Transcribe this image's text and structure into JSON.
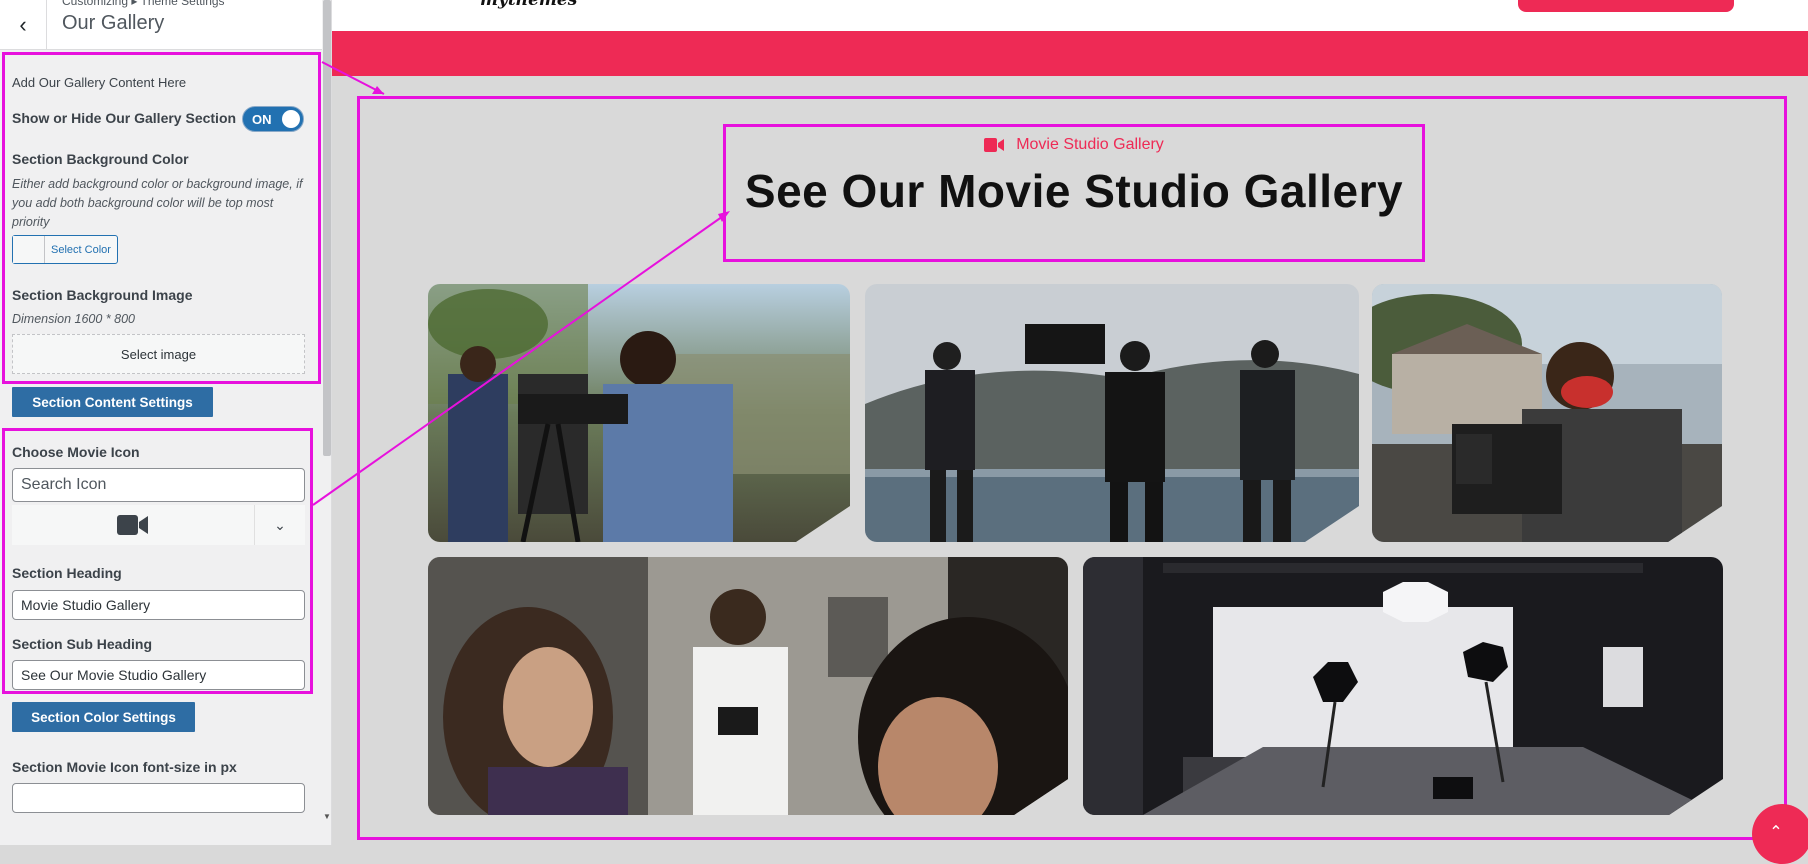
{
  "sidebar": {
    "breadcrumb": "Customizing ▸ Theme Settings",
    "title": "Our Gallery",
    "add_content_label": "Add Our Gallery Content Here",
    "show_hide_label": "Show or Hide Our Gallery Section",
    "toggle_state": "ON",
    "bg_color_label": "Section Background Color",
    "bg_color_desc": "Either add background color or background image, if you add both background color will be top most priority",
    "select_color_label": "Select Color",
    "bg_image_label": "Section Background Image",
    "bg_image_dimension": "Dimension 1600 * 800",
    "select_image_label": "Select image",
    "content_settings_button": "Section Content Settings",
    "choose_icon_label": "Choose Movie Icon",
    "search_icon_placeholder": "Search Icon",
    "selected_icon": "video-camera-icon",
    "heading_label": "Section Heading",
    "heading_value": "Movie Studio Gallery",
    "subheading_label": "Section Sub Heading",
    "subheading_value": "See Our Movie Studio Gallery",
    "color_settings_button": "Section Color Settings",
    "icon_fontsize_label": "Section Movie Icon font-size in px",
    "icon_fontsize_value": ""
  },
  "preview": {
    "logo_text": "mythemes",
    "section_small_heading": "Movie Studio Gallery",
    "section_big_heading": "See Our Movie Studio Gallery",
    "gallery_images": [
      "filmmakers-with-camera-on-tripod",
      "film-crew-by-the-lake",
      "cameraman-with-red-mask",
      "photographer-in-room",
      "empty-photo-studio-with-lights"
    ]
  },
  "colors": {
    "accent": "#ee2a55",
    "highlight": "#e711dd",
    "wp_blue": "#2e6da4"
  }
}
